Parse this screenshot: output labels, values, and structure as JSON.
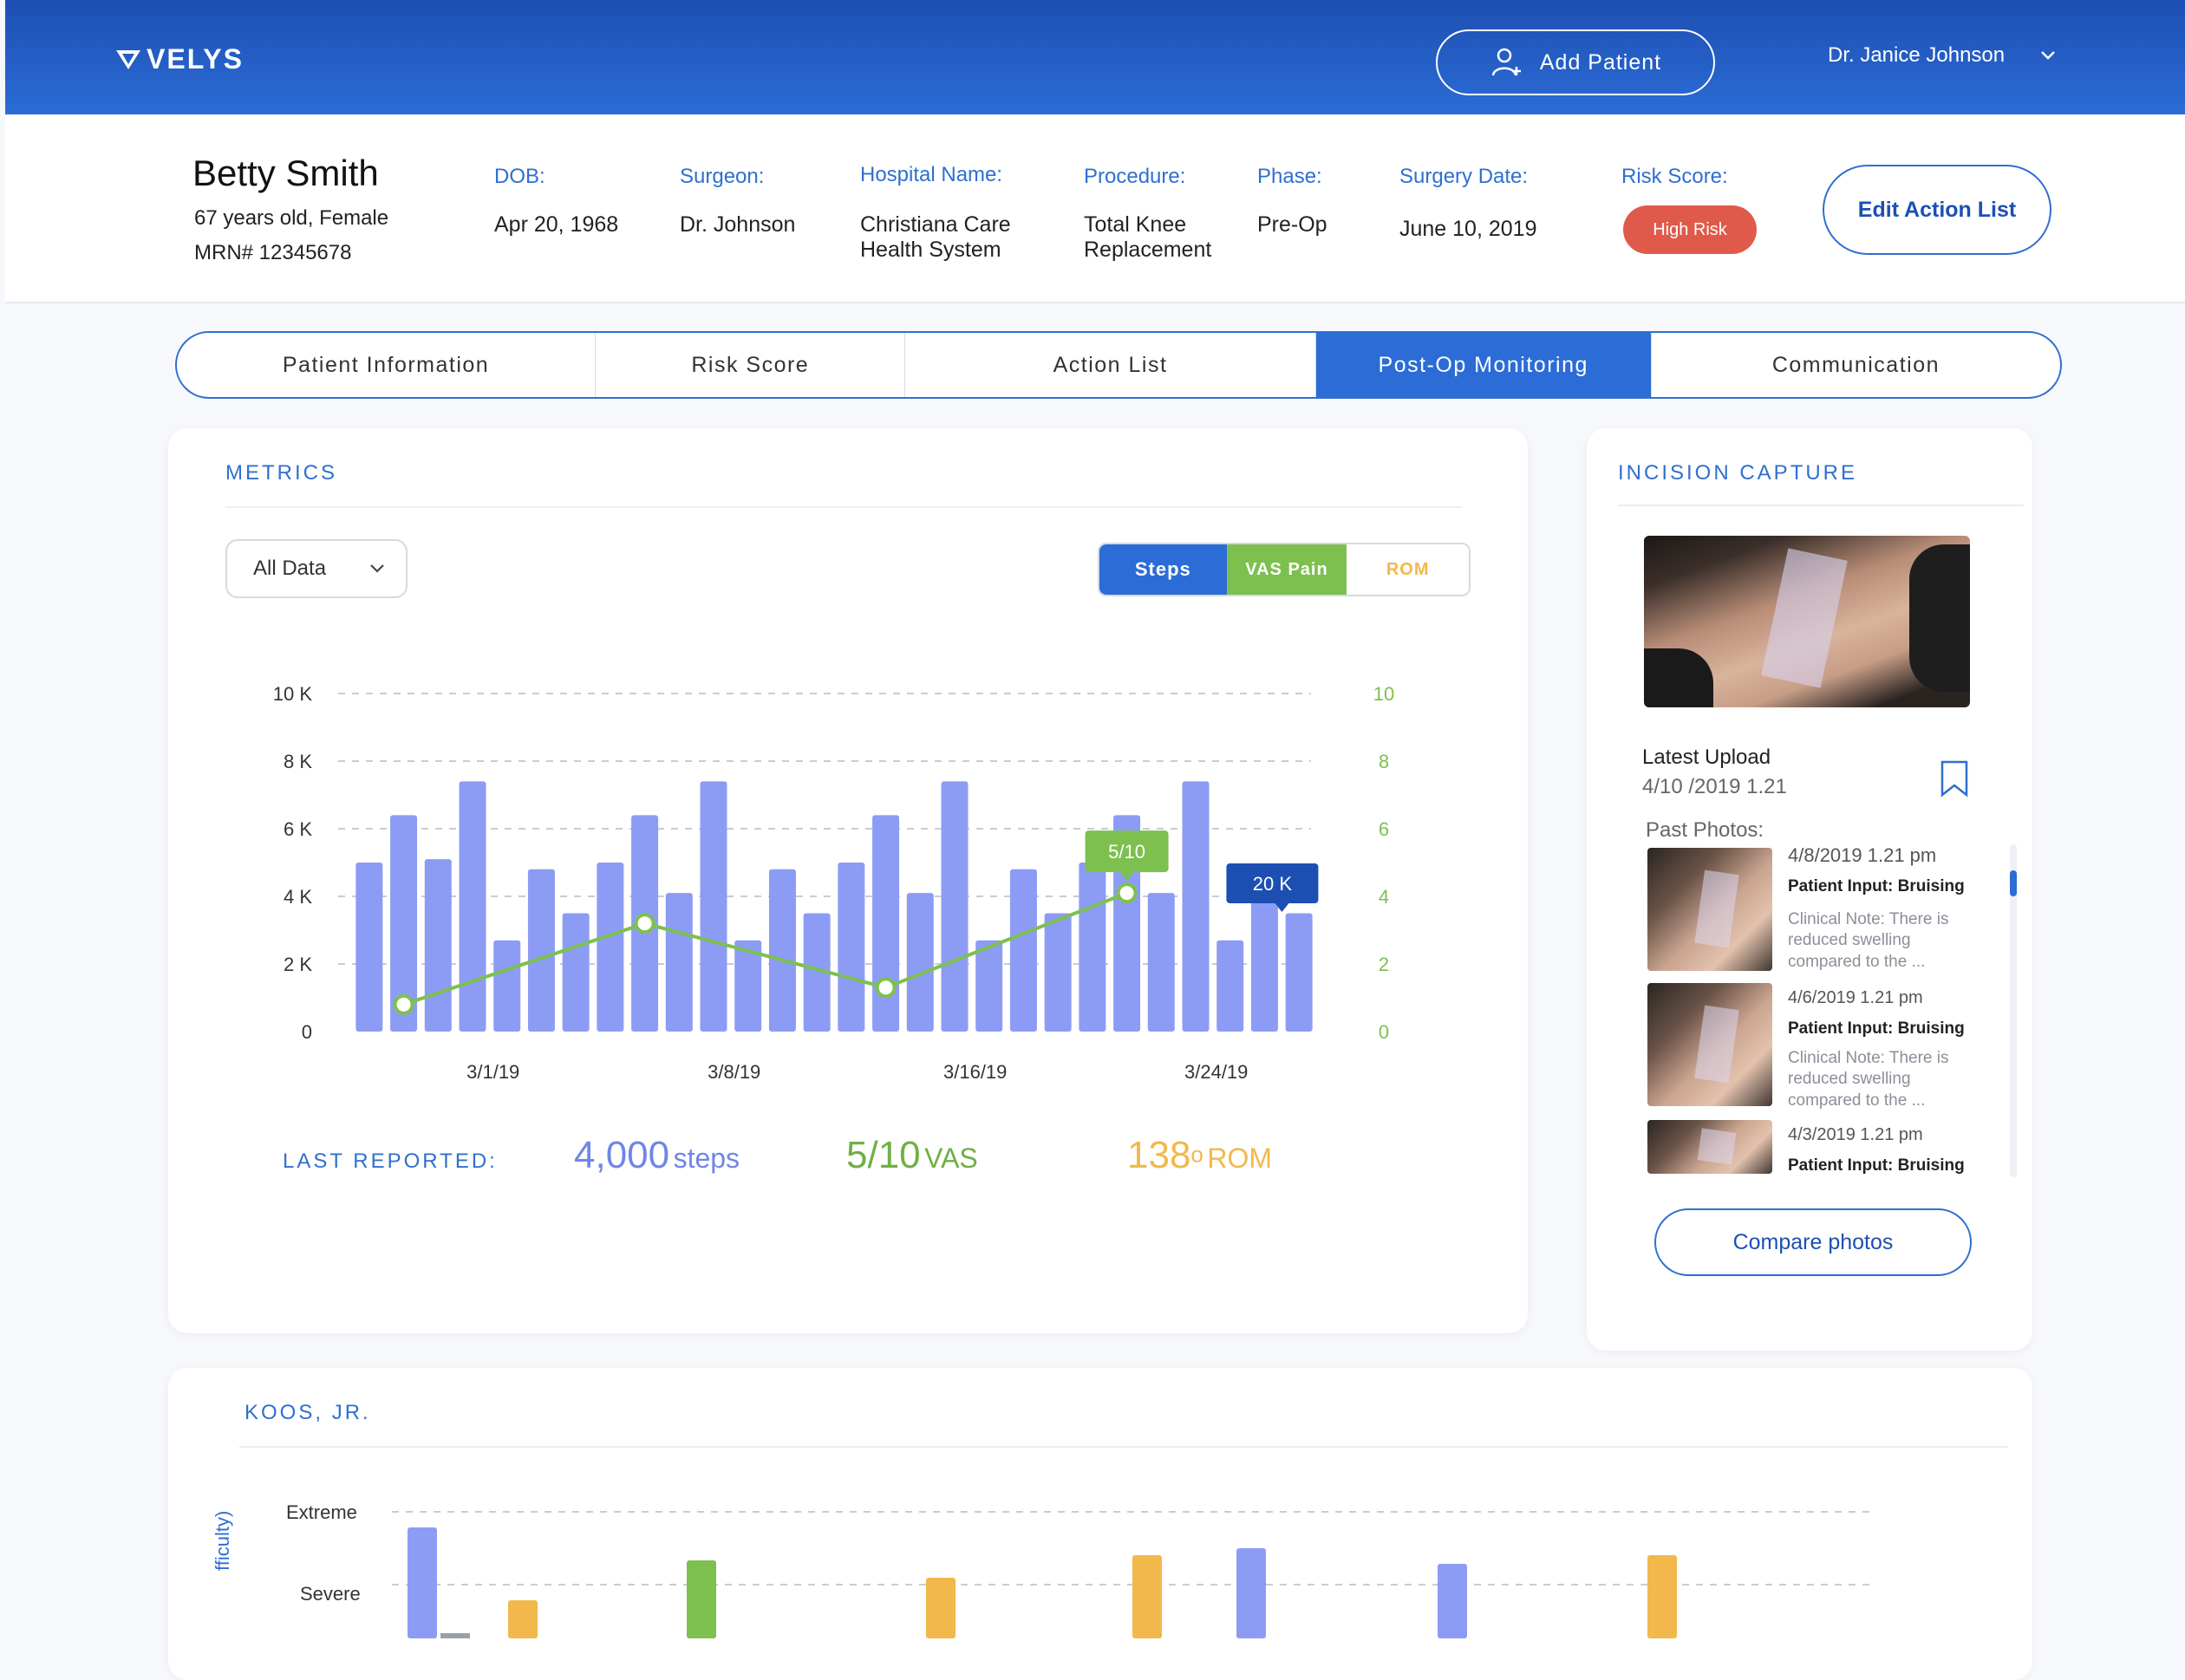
{
  "header": {
    "logo": "VELYS",
    "add_patient_label": "Add Patient",
    "user_name": "Dr.  Janice Johnson"
  },
  "patient": {
    "name": "Betty Smith",
    "age_sex": "67 years old, Female",
    "mrn": "MRN# 12345678",
    "fields": {
      "dob_label": "DOB:",
      "dob": "Apr 20, 1968",
      "surgeon_label": "Surgeon:",
      "surgeon": "Dr. Johnson",
      "hospital_label": "Hospital Name:",
      "hospital_1": "Christiana Care",
      "hospital_2": "Health System",
      "procedure_label": "Procedure:",
      "procedure_1": "Total Knee",
      "procedure_2": "Replacement",
      "phase_label": "Phase:",
      "phase": "Pre-Op",
      "surgery_date_label": "Surgery Date:",
      "surgery_date": "June 10, 2019",
      "risk_label": "Risk Score:",
      "risk": "High Risk"
    },
    "edit_action_label": "Edit Action List"
  },
  "tabs": [
    {
      "label": "Patient Information"
    },
    {
      "label": "Risk Score"
    },
    {
      "label": "Action List"
    },
    {
      "label": "Post-Op Monitoring"
    },
    {
      "label": "Communication"
    }
  ],
  "metrics": {
    "title": "METRICS",
    "filter_value": "All Data",
    "toggles": {
      "steps": "Steps",
      "vas": "VAS Pain",
      "rom": "ROM"
    },
    "colors": {
      "steps": "#2b6cd6",
      "vas": "#7dc04f",
      "rom": "#f2b84b",
      "bars": "#8c9cf5"
    },
    "last_reported": {
      "label": "LAST REPORTED:",
      "steps_value": "4,000",
      "steps_unit": "steps",
      "vas_value": "5/10",
      "vas_unit": "VAS",
      "rom_value": "138",
      "rom_sup": "o",
      "rom_unit": "ROM"
    }
  },
  "chart_data": [
    {
      "type": "bar",
      "left_axis_ticks": [
        "0",
        "2 K",
        "4 K",
        "6 K",
        "8 K",
        "10 K"
      ],
      "right_axis_ticks": [
        "0",
        "2",
        "4",
        "6",
        "8",
        "10"
      ],
      "ylim": [
        0,
        10000
      ],
      "x_tick_labels": [
        "3/1/19",
        "3/8/19",
        "3/16/19",
        "3/24/19"
      ],
      "series": [
        {
          "values": [
            5000,
            6400,
            5100,
            7400,
            2700,
            4800,
            3500,
            5000,
            6400,
            4100,
            7400,
            2700,
            4800,
            3500,
            5000,
            6400,
            4100,
            7400,
            2700,
            4800,
            3500,
            5000,
            6400,
            4100,
            7400,
            2700,
            4000,
            3500
          ]
        }
      ],
      "vas_line": {
        "x_index": [
          1,
          8,
          15,
          22
        ],
        "values": [
          0.8,
          3.2,
          1.3,
          4.1
        ]
      },
      "annotations": [
        {
          "text": "5/10",
          "color": "#7dc04f"
        },
        {
          "text": "20 K",
          "color": "#1d4fb3"
        }
      ]
    },
    {
      "type": "bar",
      "title": "KOOS, JR.",
      "ylabel": "fficulty)",
      "y_categories": [
        "Extreme",
        "Severe"
      ]
    }
  ],
  "incision": {
    "title": "INCISION CAPTURE",
    "latest_label": "Latest Upload",
    "latest_date": "4/10 /2019  1.21",
    "past_label": "Past Photos:",
    "past": [
      {
        "date": "4/8/2019  1.21 pm",
        "input": "Patient Input: Bruising",
        "note_1": "Clinical Note: There is",
        "note_2": "reduced swelling",
        "note_3": "compared to the ..."
      },
      {
        "date": "4/6/2019  1.21 pm",
        "input": "Patient Input: Bruising",
        "note_1": "Clinical Note: There is",
        "note_2": "reduced swelling",
        "note_3": "compared to the ..."
      },
      {
        "date": "4/3/2019  1.21 pm",
        "input": "Patient Input: Bruising"
      }
    ],
    "compare_label": "Compare photos"
  }
}
